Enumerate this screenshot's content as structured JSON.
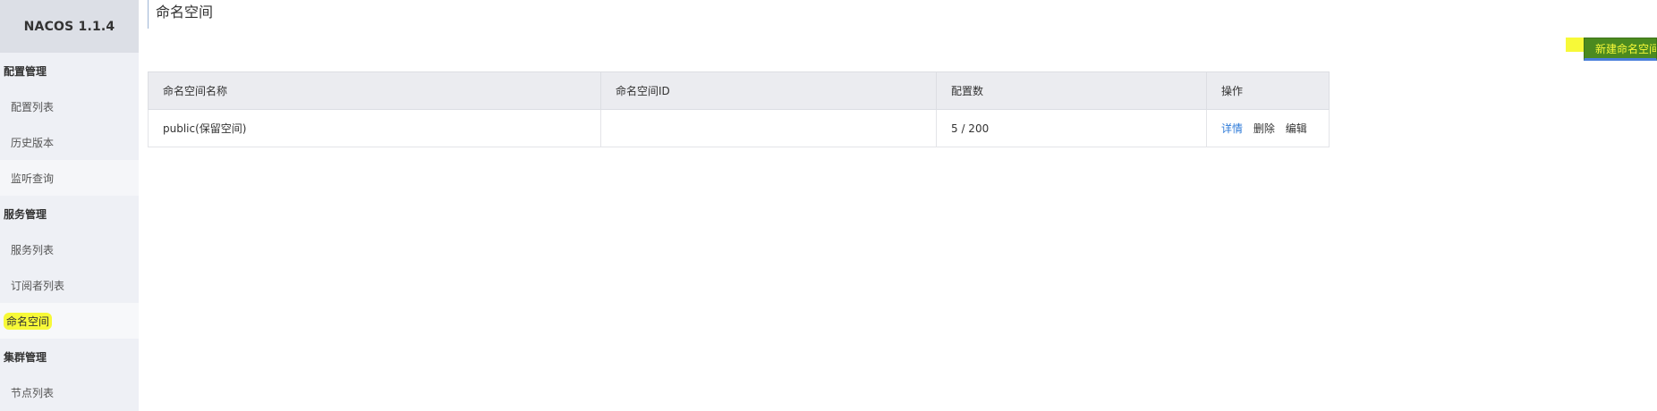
{
  "app": {
    "brand": "NACOS 1.1.4"
  },
  "sidebar": {
    "groups": [
      {
        "label": "配置管理",
        "items": [
          "配置列表",
          "历史版本",
          "监听查询"
        ]
      },
      {
        "label": "服务管理",
        "items": [
          "服务列表",
          "订阅者列表"
        ]
      },
      {
        "label": "命名空间",
        "items": []
      },
      {
        "label": "集群管理",
        "items": [
          "节点列表"
        ]
      }
    ],
    "active": "命名空间"
  },
  "page": {
    "title": "命名空间",
    "create_button": "新建命名空间"
  },
  "table": {
    "headers": [
      "命名空间名称",
      "命名空间ID",
      "配置数",
      "操作"
    ],
    "rows": [
      {
        "name": "public(保留空间)",
        "id": "",
        "config_count": "5 / 200",
        "actions": [
          "详情",
          "删除",
          "编辑"
        ]
      }
    ]
  },
  "colors": {
    "highlight": "#f7f938",
    "link": "#2f7bd8",
    "create_button_bg": "#4b8a1f",
    "sidebar_bg": "#eef0f5"
  }
}
